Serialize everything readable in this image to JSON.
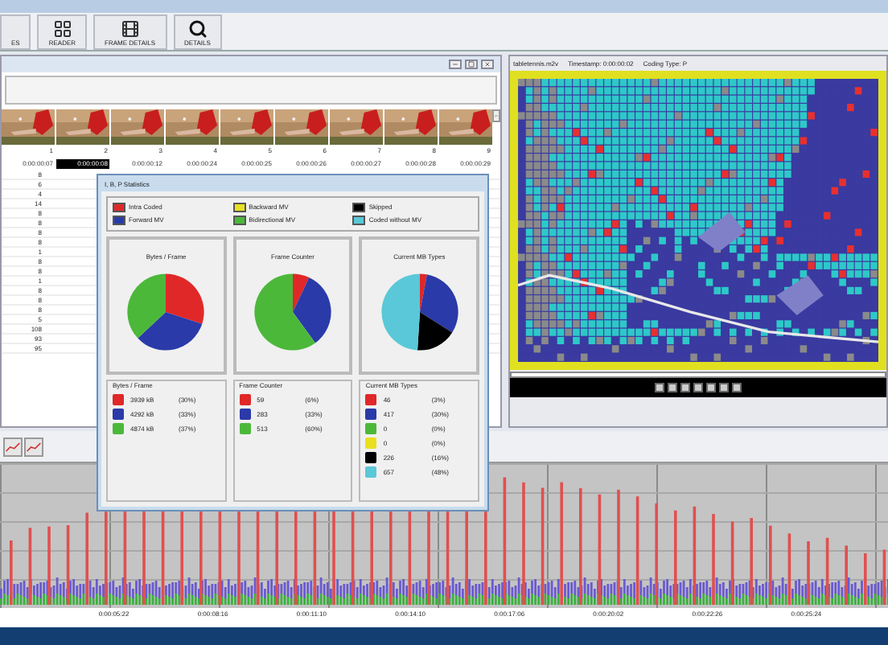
{
  "toolbar": {
    "buttons": [
      {
        "label": "ES",
        "kind": "none"
      },
      {
        "label": "READER",
        "kind": "reader"
      },
      {
        "label": "FRAME DETAILS",
        "kind": "film"
      },
      {
        "label": "DETAILS",
        "kind": "search"
      }
    ]
  },
  "frame_strip": {
    "frames": [
      {
        "number": "1",
        "timestamp": "0:00:00:07",
        "selected": false
      },
      {
        "number": "2",
        "timestamp": "0:00:00:08",
        "selected": true
      },
      {
        "number": "3",
        "timestamp": "0:00:00:12",
        "selected": false
      },
      {
        "number": "4",
        "timestamp": "0:00:00:24",
        "selected": false
      },
      {
        "number": "5",
        "timestamp": "0:00:00:25",
        "selected": false
      },
      {
        "number": "6",
        "timestamp": "0:00:00:26",
        "selected": false
      },
      {
        "number": "7",
        "timestamp": "0:00:00:27",
        "selected": false
      },
      {
        "number": "8",
        "timestamp": "0:00:00:28",
        "selected": false
      },
      {
        "number": "9",
        "timestamp": "0:00:00:29",
        "selected": false
      }
    ]
  },
  "frame_table": {
    "rows": [
      "8",
      "6",
      "4",
      "14",
      "8",
      "8",
      "8",
      "8",
      "1",
      "8",
      "8",
      "1",
      "8",
      "8",
      "8",
      "5",
      "108",
      "93",
      "95"
    ]
  },
  "viewer": {
    "file": "tabletennis.m2v",
    "timestamp": "Timestamp: 0:00:00:02",
    "coding_type": "Coding Type: P"
  },
  "statistics_dialog": {
    "title": "I, B, P Statistics",
    "legend": [
      {
        "label": "Intra Coded",
        "color": "#e02828"
      },
      {
        "label": "Backward MV",
        "color": "#e8e020"
      },
      {
        "label": "Skipped",
        "color": "#000000"
      },
      {
        "label": "Forward MV",
        "color": "#2a3aa8"
      },
      {
        "label": "Bidirectional MV",
        "color": "#4cb83a"
      },
      {
        "label": "Coded without MV",
        "color": "#5ac8d8"
      }
    ],
    "panels": [
      {
        "title": "Bytes / Frame",
        "list_title": "Bytes / Frame",
        "chart_data": {
          "type": "pie",
          "values": [
            30,
            33,
            37
          ]
        },
        "items": [
          {
            "value": "3939 kB",
            "percent": "(30%)",
            "color": "#e02828"
          },
          {
            "value": "4292 kB",
            "percent": "(33%)",
            "color": "#2a3aa8"
          },
          {
            "value": "4874 kB",
            "percent": "(37%)",
            "color": "#4cb83a"
          }
        ]
      },
      {
        "title": "Frame Counter",
        "list_title": "Frame Counter",
        "chart_data": {
          "type": "pie",
          "values": [
            7,
            33,
            60
          ]
        },
        "items": [
          {
            "value": "59",
            "percent": "(6%)",
            "color": "#e02828"
          },
          {
            "value": "283",
            "percent": "(33%)",
            "color": "#2a3aa8"
          },
          {
            "value": "513",
            "percent": "(60%)",
            "color": "#4cb83a"
          }
        ]
      },
      {
        "title": "Current MB Types",
        "list_title": "Current MB Types",
        "chart_data": {
          "type": "pie",
          "values": [
            3,
            31,
            0,
            0,
            17,
            49
          ]
        },
        "items": [
          {
            "value": "46",
            "percent": "(3%)",
            "color": "#e02828"
          },
          {
            "value": "417",
            "percent": "(30%)",
            "color": "#2a3aa8"
          },
          {
            "value": "0",
            "percent": "(0%)",
            "color": "#4cb83a"
          },
          {
            "value": "0",
            "percent": "(0%)",
            "color": "#e8e020"
          },
          {
            "value": "226",
            "percent": "(16%)",
            "color": "#000000"
          },
          {
            "value": "657",
            "percent": "(48%)",
            "color": "#5ac8d8"
          }
        ]
      }
    ]
  },
  "graph": {
    "xticks": [
      "0:00:05:22",
      "0:00:08:16",
      "0:00:11:10",
      "0:00:14:10",
      "0:00:17:06",
      "0:00:20:02",
      "0:00:22:26",
      "0:00:25:24"
    ]
  }
}
